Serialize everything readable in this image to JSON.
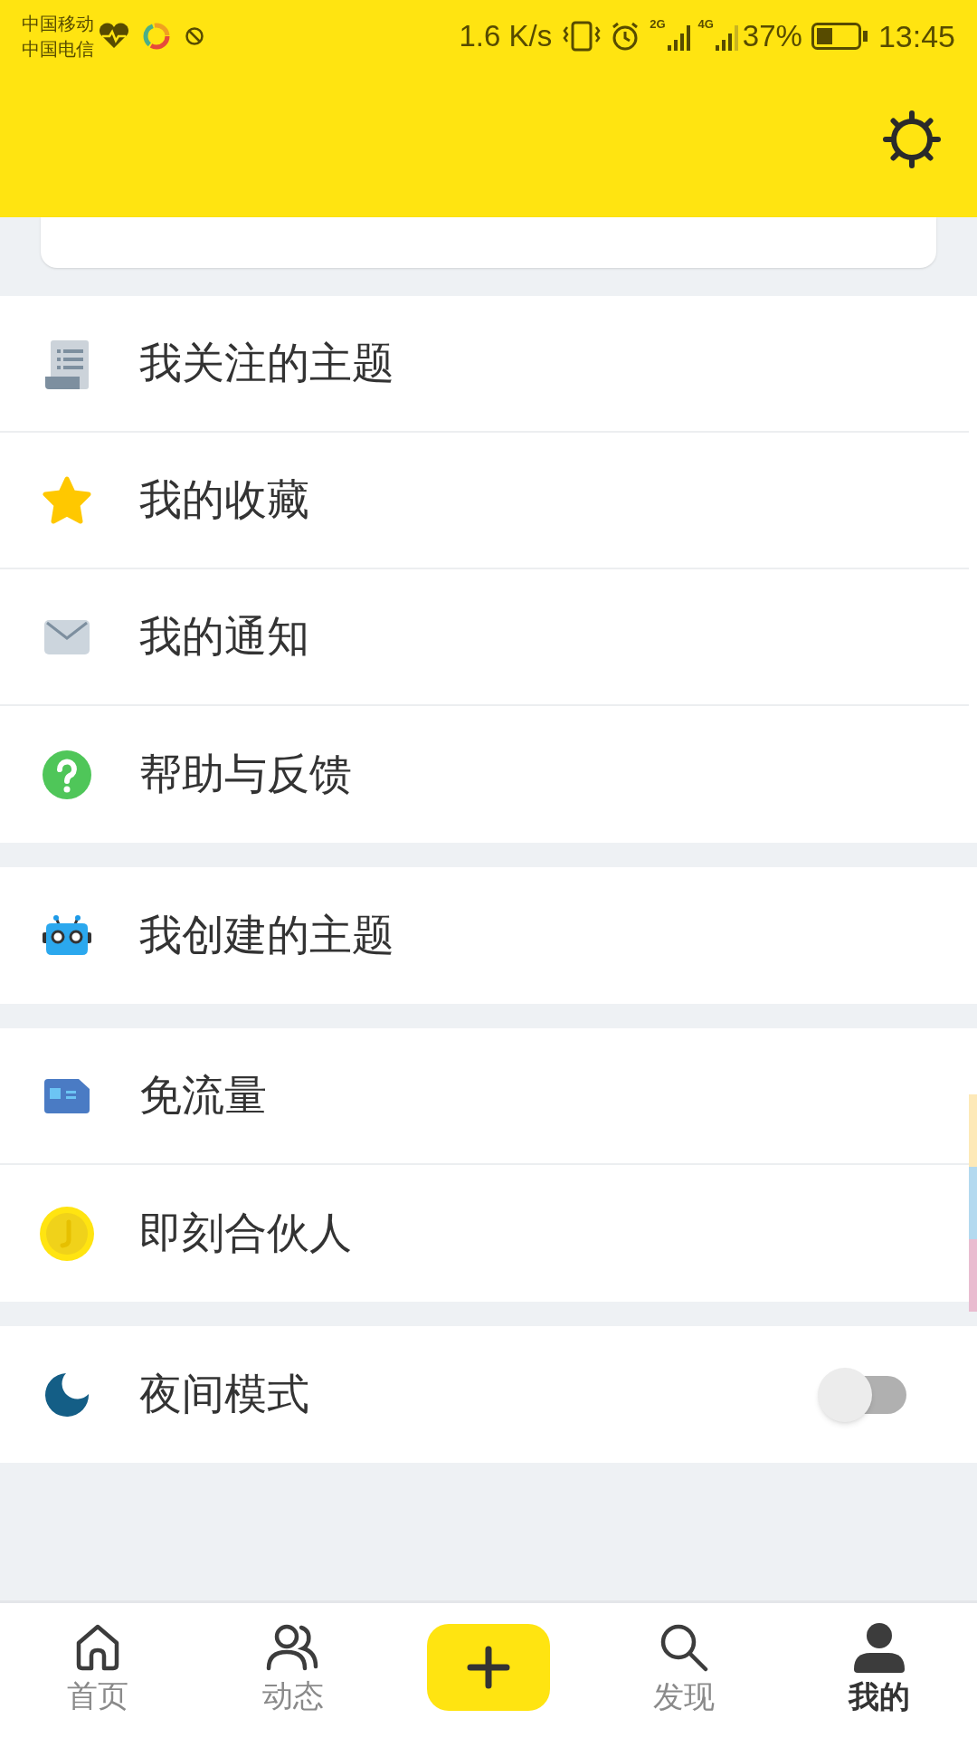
{
  "status_bar": {
    "carriers": [
      "中国移动",
      "中国电信"
    ],
    "speed": "1.6 K/s",
    "network_types": [
      "2G",
      "4G"
    ],
    "battery_text": "37%",
    "time": "13:45"
  },
  "menu_groups": [
    {
      "items": [
        {
          "label": "我关注的主题",
          "kind": "link"
        },
        {
          "label": "我的收藏",
          "kind": "link"
        },
        {
          "label": "我的通知",
          "kind": "link"
        },
        {
          "label": "帮助与反馈",
          "kind": "link"
        }
      ]
    },
    {
      "items": [
        {
          "label": "我创建的主题",
          "kind": "link"
        }
      ]
    },
    {
      "items": [
        {
          "label": "免流量",
          "kind": "link"
        },
        {
          "label": "即刻合伙人",
          "kind": "link"
        }
      ]
    },
    {
      "items": [
        {
          "label": "夜间模式",
          "kind": "toggle",
          "on": false
        }
      ]
    }
  ],
  "bottom_nav": [
    {
      "kind": "tab",
      "label": "首页",
      "selected": false
    },
    {
      "kind": "tab",
      "label": "动态",
      "selected": false
    },
    {
      "kind": "add"
    },
    {
      "kind": "tab",
      "label": "发现",
      "selected": false
    },
    {
      "kind": "tab",
      "label": "我的",
      "selected": true
    }
  ]
}
